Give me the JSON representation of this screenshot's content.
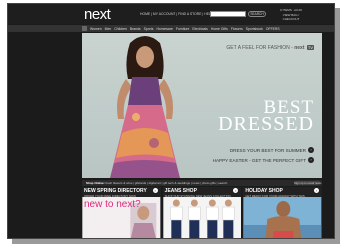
{
  "header": {
    "logo": "next",
    "top_links": "HOME | MY ACCOUNT | FIND A STORE | HELP",
    "search_label": "SEARCH",
    "account_lines": [
      "0 ITEMS · £0.00",
      "VIEW BAG / CHECKOUT"
    ]
  },
  "nav": {
    "items": [
      "Women",
      "Men",
      "Children",
      "Brands",
      "Sports",
      "Homeware",
      "Furniture",
      "Electricals",
      "Home Gifts",
      "Flowers",
      "Sportsbook",
      "OFFERS"
    ]
  },
  "hero": {
    "tagline": "GET A FEEL FOR FASHION -",
    "tagline_brand": "next",
    "tv": "TV",
    "headline_1": "BEST",
    "headline_2": "DRESSED",
    "promo_1": "DRESS YOUR BEST FOR SUMMER",
    "promo_2": "HAPPY EASTER - GET THE PERFECT GIFT"
  },
  "infobar": {
    "label": "Shop Online:",
    "links": "fresh flowers & wine | giftcards | digital art | gift tech & weddings | news | photo gifts | search",
    "signup": "Sign up to email news"
  },
  "tiles": [
    {
      "title": "NEW SPRING DIRECTORY",
      "sub": "ORDER YOUR FREE DIRECTORY NOW",
      "image": "new to next?"
    },
    {
      "title": "JEANS SHOP",
      "sub": "SHOP OUR STUNNING NEW JEANS COLLECTION",
      "image": ""
    },
    {
      "title": "HOLIDAY SHOP",
      "sub": "GET READY FOR YOUR HOLIDAY WITH THIS",
      "image": ""
    }
  ],
  "colors": {
    "background": "#1b1b1b",
    "hero_bg": "#c4cfcb",
    "accent_pink": "#e02a7d"
  }
}
